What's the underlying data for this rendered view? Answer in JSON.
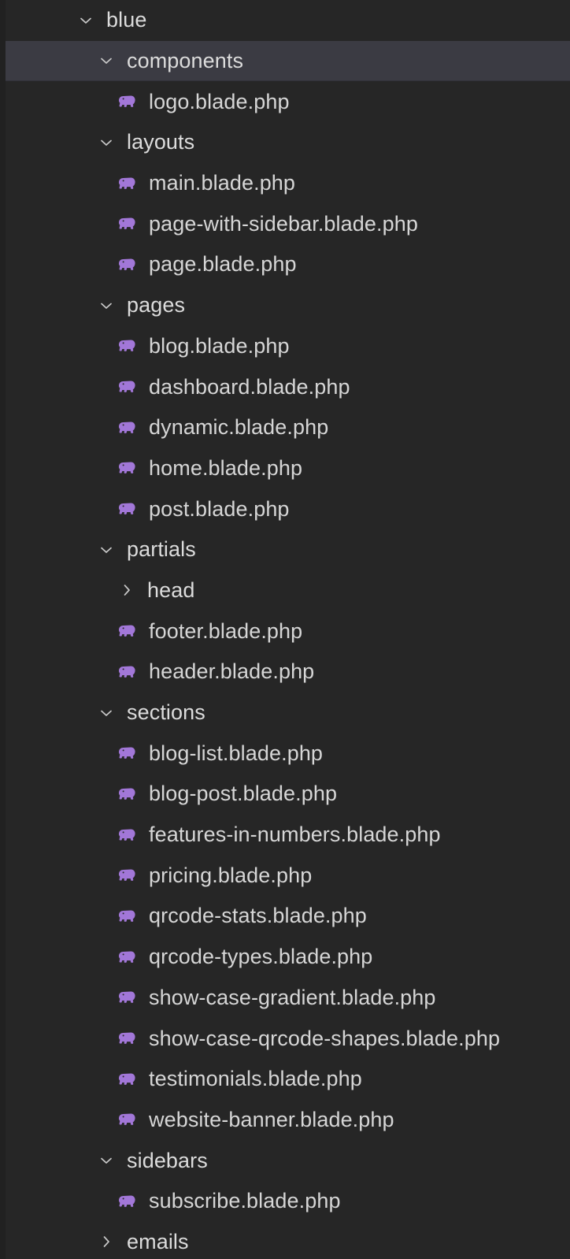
{
  "explorer": {
    "name": "file-explorer-tree",
    "theme": {
      "background": "#262626",
      "selected_row_background": "#3b3b43",
      "text_color": "#d6d6d6",
      "php_icon_color": "#a277d8",
      "chevron_color": "#c9c9c9"
    },
    "rows": [
      {
        "label": "blue",
        "type": "folder",
        "state": "expanded",
        "depth": 0,
        "selected": false
      },
      {
        "label": "components",
        "type": "folder",
        "state": "expanded",
        "depth": 1,
        "selected": true
      },
      {
        "label": "logo.blade.php",
        "type": "php",
        "state": "",
        "depth": 2,
        "selected": false
      },
      {
        "label": "layouts",
        "type": "folder",
        "state": "expanded",
        "depth": 1,
        "selected": false
      },
      {
        "label": "main.blade.php",
        "type": "php",
        "state": "",
        "depth": 2,
        "selected": false
      },
      {
        "label": "page-with-sidebar.blade.php",
        "type": "php",
        "state": "",
        "depth": 2,
        "selected": false
      },
      {
        "label": "page.blade.php",
        "type": "php",
        "state": "",
        "depth": 2,
        "selected": false
      },
      {
        "label": "pages",
        "type": "folder",
        "state": "expanded",
        "depth": 1,
        "selected": false
      },
      {
        "label": "blog.blade.php",
        "type": "php",
        "state": "",
        "depth": 2,
        "selected": false
      },
      {
        "label": "dashboard.blade.php",
        "type": "php",
        "state": "",
        "depth": 2,
        "selected": false
      },
      {
        "label": "dynamic.blade.php",
        "type": "php",
        "state": "",
        "depth": 2,
        "selected": false
      },
      {
        "label": "home.blade.php",
        "type": "php",
        "state": "",
        "depth": 2,
        "selected": false
      },
      {
        "label": "post.blade.php",
        "type": "php",
        "state": "",
        "depth": 2,
        "selected": false
      },
      {
        "label": "partials",
        "type": "folder",
        "state": "expanded",
        "depth": 1,
        "selected": false
      },
      {
        "label": "head",
        "type": "folder",
        "state": "collapsed",
        "depth": 2,
        "selected": false
      },
      {
        "label": "footer.blade.php",
        "type": "php",
        "state": "",
        "depth": 2,
        "selected": false
      },
      {
        "label": "header.blade.php",
        "type": "php",
        "state": "",
        "depth": 2,
        "selected": false
      },
      {
        "label": "sections",
        "type": "folder",
        "state": "expanded",
        "depth": 1,
        "selected": false
      },
      {
        "label": "blog-list.blade.php",
        "type": "php",
        "state": "",
        "depth": 2,
        "selected": false
      },
      {
        "label": "blog-post.blade.php",
        "type": "php",
        "state": "",
        "depth": 2,
        "selected": false
      },
      {
        "label": "features-in-numbers.blade.php",
        "type": "php",
        "state": "",
        "depth": 2,
        "selected": false
      },
      {
        "label": "pricing.blade.php",
        "type": "php",
        "state": "",
        "depth": 2,
        "selected": false
      },
      {
        "label": "qrcode-stats.blade.php",
        "type": "php",
        "state": "",
        "depth": 2,
        "selected": false
      },
      {
        "label": "qrcode-types.blade.php",
        "type": "php",
        "state": "",
        "depth": 2,
        "selected": false
      },
      {
        "label": "show-case-gradient.blade.php",
        "type": "php",
        "state": "",
        "depth": 2,
        "selected": false
      },
      {
        "label": "show-case-qrcode-shapes.blade.php",
        "type": "php",
        "state": "",
        "depth": 2,
        "selected": false
      },
      {
        "label": "testimonials.blade.php",
        "type": "php",
        "state": "",
        "depth": 2,
        "selected": false
      },
      {
        "label": "website-banner.blade.php",
        "type": "php",
        "state": "",
        "depth": 2,
        "selected": false
      },
      {
        "label": "sidebars",
        "type": "folder",
        "state": "expanded",
        "depth": 1,
        "selected": false
      },
      {
        "label": "subscribe.blade.php",
        "type": "php",
        "state": "",
        "depth": 2,
        "selected": false
      },
      {
        "label": "emails",
        "type": "folder",
        "state": "collapsed",
        "depth": 1,
        "selected": false
      }
    ]
  }
}
